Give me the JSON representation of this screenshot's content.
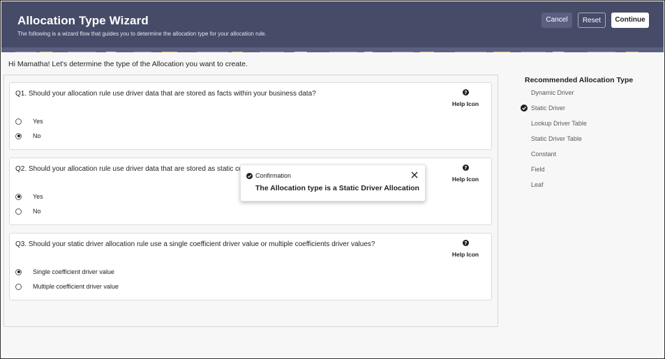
{
  "header": {
    "title": "Allocation Type Wizard",
    "subtitle": "The following is a wizard flow that guides you to determine the allocation type for your allocation rule.",
    "cancel_label": "Cancel",
    "reset_label": "Reset",
    "continue_label": "Continue"
  },
  "greeting": "Hi Mamatha! Let's determine the type of the Allocation you want to create.",
  "questions": [
    {
      "text": "Q1. Should your allocation rule use driver data that are stored as facts within your business data?",
      "help_label": "Help Icon",
      "options": [
        {
          "label": "Yes",
          "selected": false
        },
        {
          "label": "No",
          "selected": true
        }
      ]
    },
    {
      "text": "Q2. Should your allocation rule use driver data that are stored as static com",
      "help_label": "Help Icon",
      "options": [
        {
          "label": "Yes",
          "selected": true
        },
        {
          "label": "No",
          "selected": false
        }
      ]
    },
    {
      "text": "Q3. Should your static driver allocation rule use a single coefficient driver value or multiple coefficients driver values?",
      "help_label": "Help Icon",
      "options": [
        {
          "label": "Single coefficient driver value",
          "selected": true
        },
        {
          "label": "Multiple coefficient driver value",
          "selected": false
        }
      ]
    }
  ],
  "recommended": {
    "title": "Recommended Allocation Type",
    "items": [
      {
        "label": "Dynamic Driver",
        "checked": false
      },
      {
        "label": "Static Driver",
        "checked": true
      },
      {
        "label": "Lookup Driver Table",
        "checked": false
      },
      {
        "label": "Static Driver Table",
        "checked": false
      },
      {
        "label": "Constant",
        "checked": false
      },
      {
        "label": "Field",
        "checked": false
      },
      {
        "label": "Leaf",
        "checked": false
      }
    ]
  },
  "toast": {
    "heading": "Confirmation",
    "message": "The Allocation type is a Static Driver Allocation",
    "icon": "check-circle-icon"
  },
  "colors": {
    "header_bg": "#464b68",
    "banner_bg": "#5b6081",
    "accent": "#1f1f1f"
  }
}
